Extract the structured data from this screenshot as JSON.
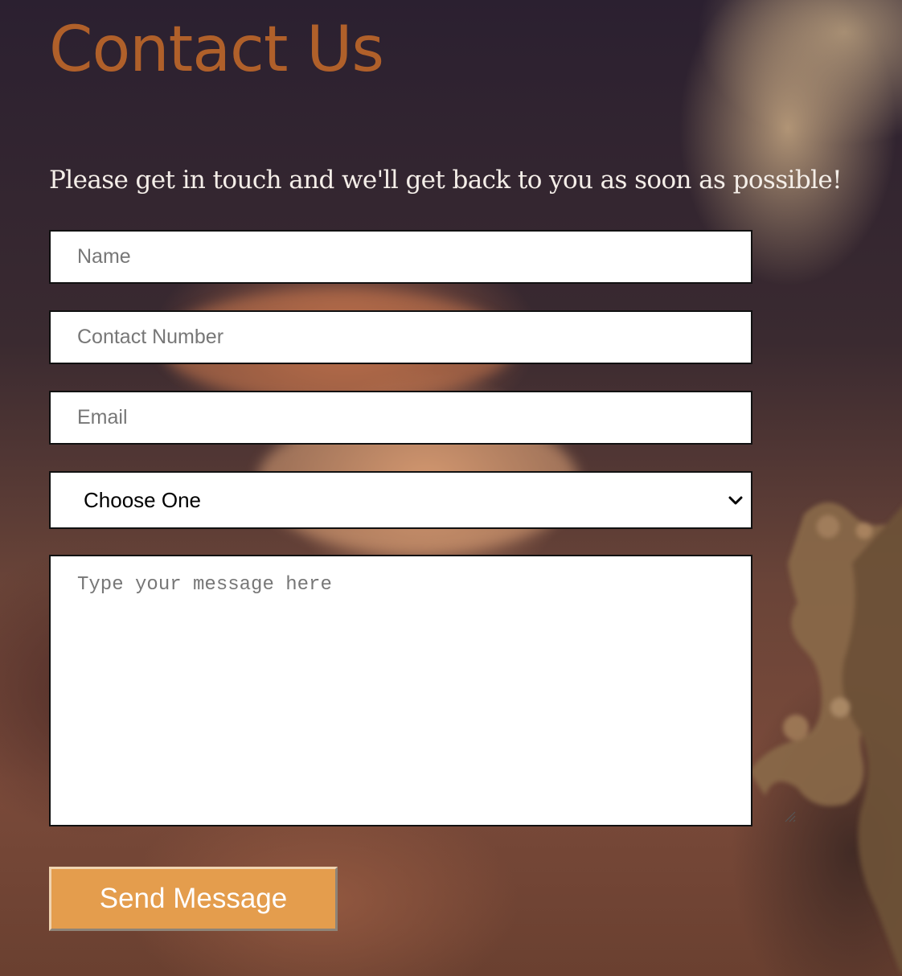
{
  "page": {
    "title": "Contact Us",
    "intro": "Please get in touch and we'll get back to you as soon as possible!"
  },
  "form": {
    "name_placeholder": "Name",
    "contact_placeholder": "Contact Number",
    "email_placeholder": "Email",
    "select_value": "Choose One",
    "message_placeholder": "Type your message here",
    "submit_label": "Send Message"
  },
  "colors": {
    "title": "#b0602a",
    "button": "#e49d4d",
    "intro_text": "#f4eee8",
    "field_border": "#111111"
  },
  "icons": {
    "select_arrow": "chevron-down-icon",
    "textarea_grip": "resize-grip-icon"
  }
}
